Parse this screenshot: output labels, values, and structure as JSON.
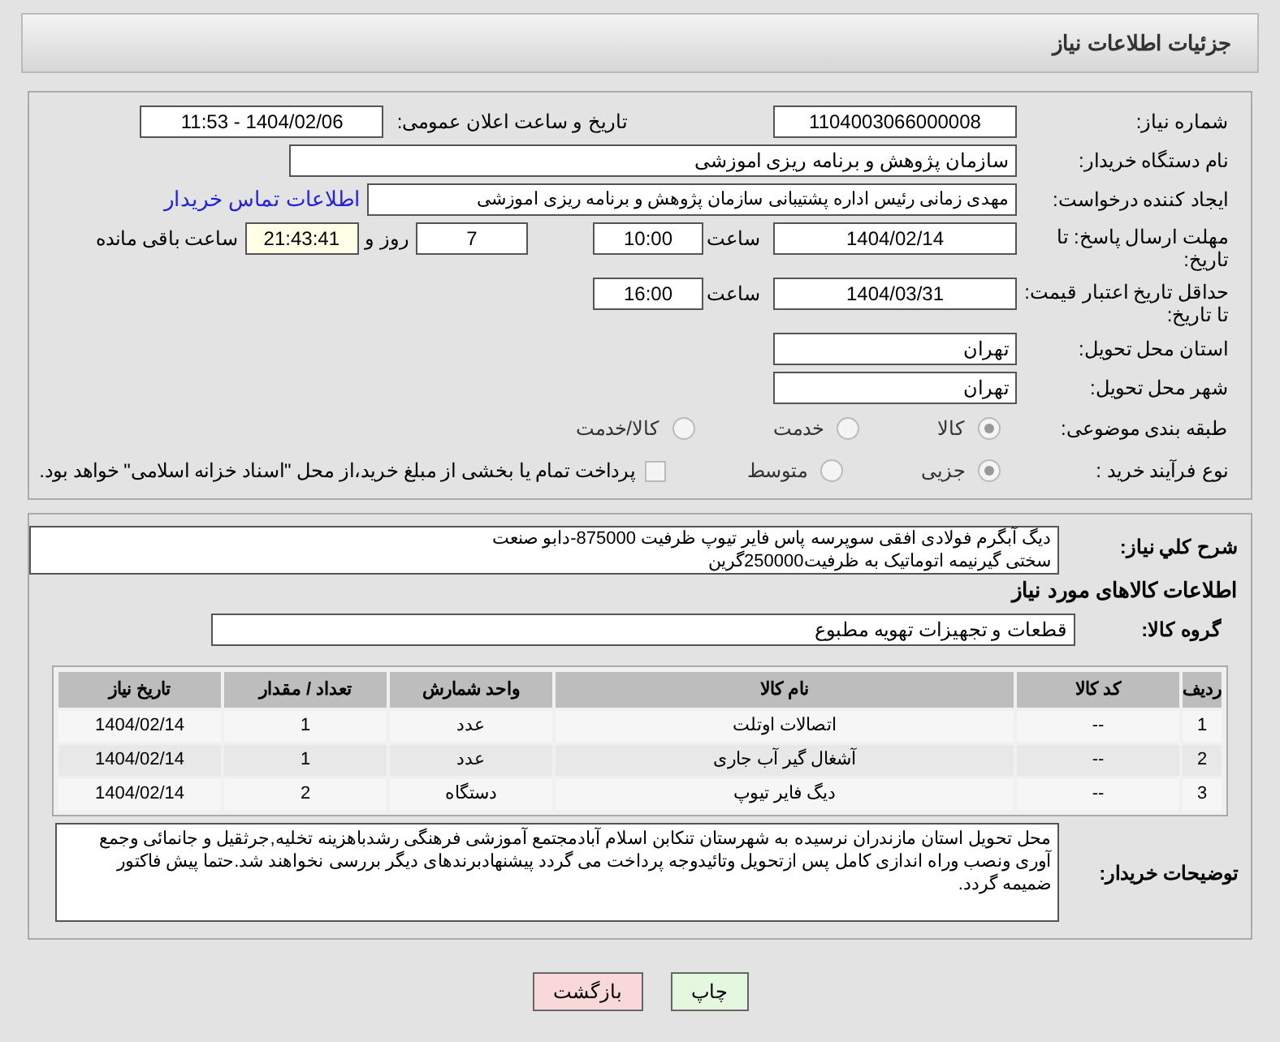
{
  "header": {
    "title": "جزئیات اطلاعات نیاز"
  },
  "need_number": {
    "label": "شماره نیاز:",
    "value": "1104003066000008"
  },
  "announce": {
    "label": "تاریخ و ساعت اعلان عمومی:",
    "value": "1404/02/06 - 11:53"
  },
  "buyer_org": {
    "label": "نام دستگاه خریدار:",
    "value": "سازمان پژوهش و برنامه ریزی اموزشی"
  },
  "requester": {
    "label": "ایجاد کننده درخواست:",
    "value": "مهدی زمانی رئیس اداره پشتیبانی سازمان پژوهش و برنامه ریزی اموزشی",
    "link": "اطلاعات تماس خریدار"
  },
  "deadline": {
    "label": "مهلت ارسال پاسخ: تا تاریخ:",
    "date": "1404/02/14",
    "time_label": "ساعت",
    "time": "10:00",
    "days": "7",
    "days_label": "روز و",
    "remaining": "21:43:41",
    "remaining_label": "ساعت باقی مانده"
  },
  "validity": {
    "label": "حداقل تاریخ اعتبار قیمت: تا تاریخ:",
    "date": "1404/03/31",
    "time_label": "ساعت",
    "time": "16:00"
  },
  "province": {
    "label": "استان محل تحویل:",
    "value": "تهران"
  },
  "city": {
    "label": "شهر محل تحویل:",
    "value": "تهران"
  },
  "category": {
    "label": "طبقه بندی موضوعی:",
    "options": [
      {
        "label": "کالا",
        "selected": true
      },
      {
        "label": "خدمت",
        "selected": false
      },
      {
        "label": "کالا/خدمت",
        "selected": false
      }
    ]
  },
  "process": {
    "label": "نوع فرآیند خرید :",
    "options": [
      {
        "label": "جزیی",
        "selected": true
      },
      {
        "label": "متوسط",
        "selected": false
      }
    ],
    "treasury": {
      "checked": false,
      "label": "پرداخت تمام یا بخشی از مبلغ خرید،از محل \"اسناد خزانه اسلامی\" خواهد بود."
    }
  },
  "summary": {
    "label": "شرح کلي نياز:",
    "lines": [
      "دیگ آبگرم فولادی افقی سوپرسه پاس فایر تیوپ ظرفیت 875000-دابو صنعت",
      "سختی گیرنیمه اتوماتیک به ظرفیت250000گرین"
    ]
  },
  "goods_heading": "اطلاعات کالاهای مورد نیاز",
  "goods_group": {
    "label": "گروه کالا:",
    "value": "قطعات و تجهیزات تهویه مطبوع"
  },
  "table": {
    "columns": [
      "ردیف",
      "کد کالا",
      "نام کالا",
      "واحد شمارش",
      "تعداد / مقدار",
      "تاریخ نیاز"
    ],
    "rows": [
      [
        "1",
        "--",
        "اتصالات اوتلت",
        "عدد",
        "1",
        "1404/02/14"
      ],
      [
        "2",
        "--",
        "آشغال گیر آب جاری",
        "عدد",
        "1",
        "1404/02/14"
      ],
      [
        "3",
        "--",
        "دیگ فایر تیوپ",
        "دستگاه",
        "2",
        "1404/02/14"
      ]
    ]
  },
  "buyer_notes": {
    "label": "توضیحات خریدار:",
    "value": "محل تحویل استان مازندران نرسیده به شهرستان تنکابن اسلام آبادمجتمع آموزشی فرهنگی رشدباهزینه تخلیه,جرثقیل و جانمائی وجمع آوری ونصب وراه اندازی کامل پس ازتحویل وتائیدوجه پرداخت می گردد پیشنهادبرندهای دیگر بررسی نخواهند شد.حتما پیش فاکتور ضمیمه گردد."
  },
  "buttons": [
    {
      "kind": "print",
      "label": "چاپ"
    },
    {
      "kind": "back",
      "label": "بازگشت"
    }
  ]
}
